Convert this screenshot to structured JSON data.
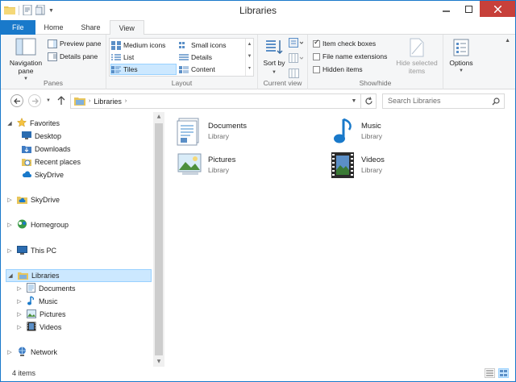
{
  "window": {
    "title": "Libraries"
  },
  "tabs": [
    {
      "label": "File"
    },
    {
      "label": "Home"
    },
    {
      "label": "Share"
    },
    {
      "label": "View"
    }
  ],
  "ribbon": {
    "panes": {
      "group_label": "Panes",
      "navigation_pane": "Navigation pane",
      "preview_pane": "Preview pane",
      "details_pane": "Details pane"
    },
    "layout": {
      "group_label": "Layout",
      "options": [
        "Medium icons",
        "Small icons",
        "List",
        "Details",
        "Tiles",
        "Content"
      ],
      "selected": "Tiles"
    },
    "current_view": {
      "group_label": "Current view",
      "sort_by": "Sort by"
    },
    "show_hide": {
      "group_label": "Show/hide",
      "item_check_boxes": {
        "label": "Item check boxes",
        "checked": true
      },
      "file_name_extensions": {
        "label": "File name extensions",
        "checked": false
      },
      "hidden_items": {
        "label": "Hidden items",
        "checked": false
      },
      "hide_selected_items": "Hide selected items"
    },
    "options": "Options"
  },
  "address": {
    "path": "Libraries",
    "search_placeholder": "Search Libraries"
  },
  "nav": {
    "favorites": "Favorites",
    "desktop": "Desktop",
    "downloads": "Downloads",
    "recent_places": "Recent places",
    "skydrive_fav": "SkyDrive",
    "skydrive": "SkyDrive",
    "homegroup": "Homegroup",
    "this_pc": "This PC",
    "libraries": "Libraries",
    "lib_documents": "Documents",
    "lib_music": "Music",
    "lib_pictures": "Pictures",
    "lib_videos": "Videos",
    "network": "Network"
  },
  "content": {
    "tiles": [
      {
        "name": "Documents",
        "type": "Library"
      },
      {
        "name": "Music",
        "type": "Library"
      },
      {
        "name": "Pictures",
        "type": "Library"
      },
      {
        "name": "Videos",
        "type": "Library"
      }
    ]
  },
  "status": {
    "item_count": "4 items"
  },
  "colors": {
    "accent": "#1979ca",
    "selection": "#cce8ff",
    "close": "#c7403a"
  }
}
